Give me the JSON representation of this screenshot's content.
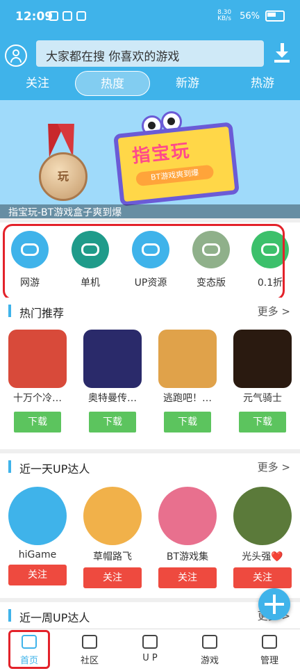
{
  "status_bar": {
    "time": "12:09",
    "network_speed": "8.30 KB/s",
    "battery": "56%"
  },
  "header": {
    "search_placeholder": "大家都在搜  你喜欢的游戏",
    "tabs": [
      {
        "label": "关注",
        "active": false
      },
      {
        "label": "热度",
        "active": true
      },
      {
        "label": "新游",
        "active": false
      },
      {
        "label": "热游",
        "active": false
      }
    ]
  },
  "banner": {
    "title": "指宝玩",
    "subtitle": "BT游戏爽到爆",
    "medal_text": "玩",
    "caption": "指宝玩-BT游戏盒子爽到爆"
  },
  "categories": [
    {
      "label": "网游",
      "color": "#3fb3ea"
    },
    {
      "label": "单机",
      "color": "#1f9b8a"
    },
    {
      "label": "UP资源",
      "color": "#3fb3ea"
    },
    {
      "label": "变态版",
      "color": "#8fb08a"
    },
    {
      "label": "0.1折",
      "color": "#3cc06b"
    }
  ],
  "hot": {
    "title": "热门推荐",
    "more": "更多 >",
    "games": [
      {
        "name": "十万个冷…",
        "button": "下载",
        "thumb": "#d84a3a"
      },
      {
        "name": "奥特曼传…",
        "button": "下载",
        "thumb": "#2a2a6a"
      },
      {
        "name": "逃跑吧！…",
        "button": "下载",
        "thumb": "#e0a24a"
      },
      {
        "name": "元气骑士",
        "button": "下载",
        "thumb": "#2a1a10"
      }
    ]
  },
  "up_day": {
    "title": "近一天UP达人",
    "more": "更多 >",
    "users": [
      {
        "name": "hiGame",
        "button": "关注",
        "color": "#3fb3ea"
      },
      {
        "name": "草帽路飞",
        "button": "关注",
        "color": "#f1b14a"
      },
      {
        "name": "BT游戏集",
        "button": "关注",
        "color": "#e8708e"
      },
      {
        "name": "光头强❤️",
        "button": "关注",
        "color": "#5b7a3a"
      }
    ]
  },
  "up_week": {
    "title": "近一周UP达人",
    "more": "更多 >"
  },
  "nav": [
    {
      "label": "首页",
      "active": true
    },
    {
      "label": "社区",
      "active": false
    },
    {
      "label": "U P",
      "active": false
    },
    {
      "label": "游戏",
      "active": false
    },
    {
      "label": "管理",
      "active": false
    }
  ]
}
